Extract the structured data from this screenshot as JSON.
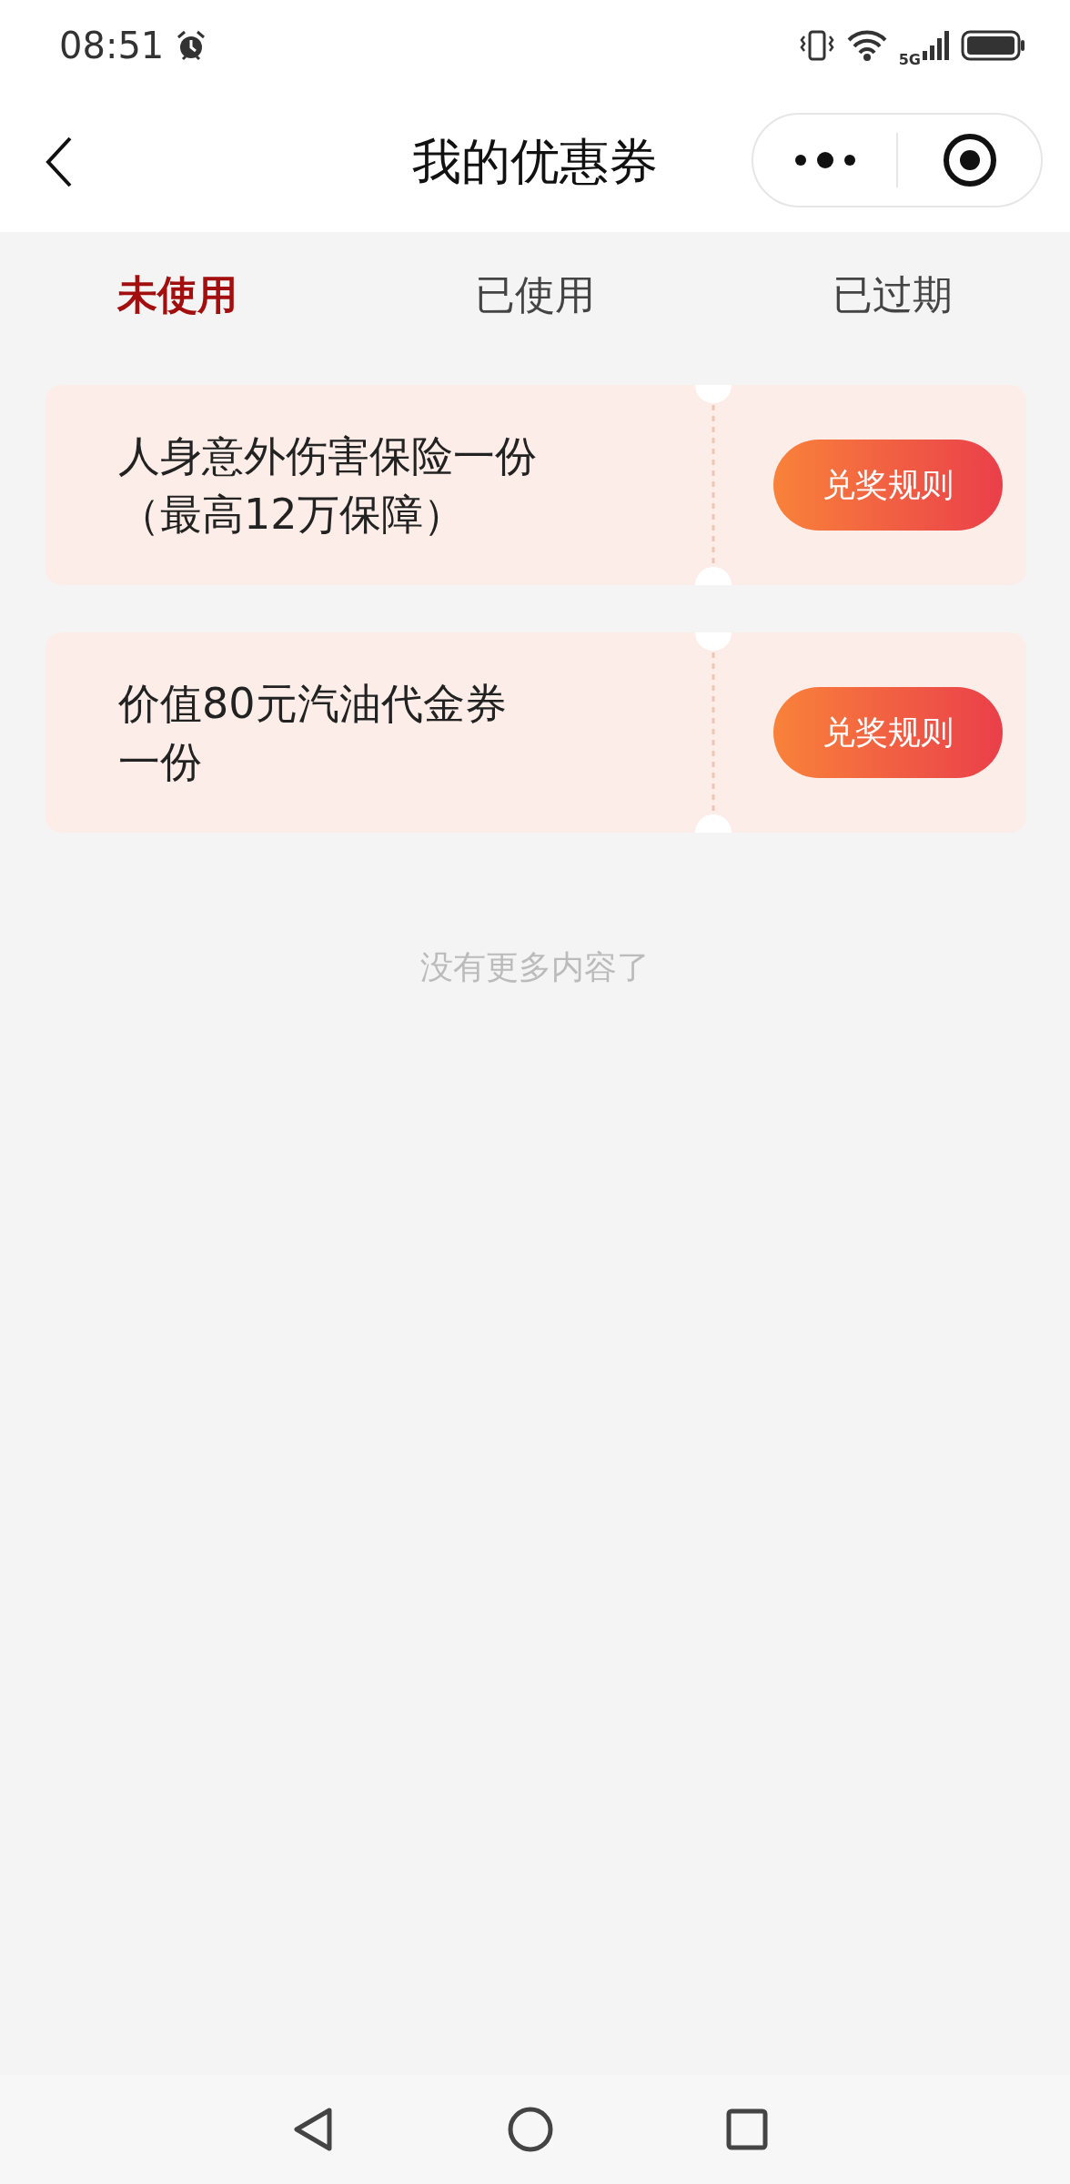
{
  "status_bar": {
    "time": "08:51",
    "network": "5G"
  },
  "header": {
    "title": "我的优惠券"
  },
  "tabs": [
    {
      "label": "未使用",
      "selected": true
    },
    {
      "label": "已使用",
      "selected": false
    },
    {
      "label": "已过期",
      "selected": false
    }
  ],
  "coupons": [
    {
      "title_lines": [
        "人身意外伤害保险一份",
        "（最高12万保障）"
      ],
      "button": "兑奖规则"
    },
    {
      "title_lines": [
        "价值80元汽油代金券",
        "一份"
      ],
      "button": "兑奖规则"
    }
  ],
  "end_text": "没有更多内容了"
}
